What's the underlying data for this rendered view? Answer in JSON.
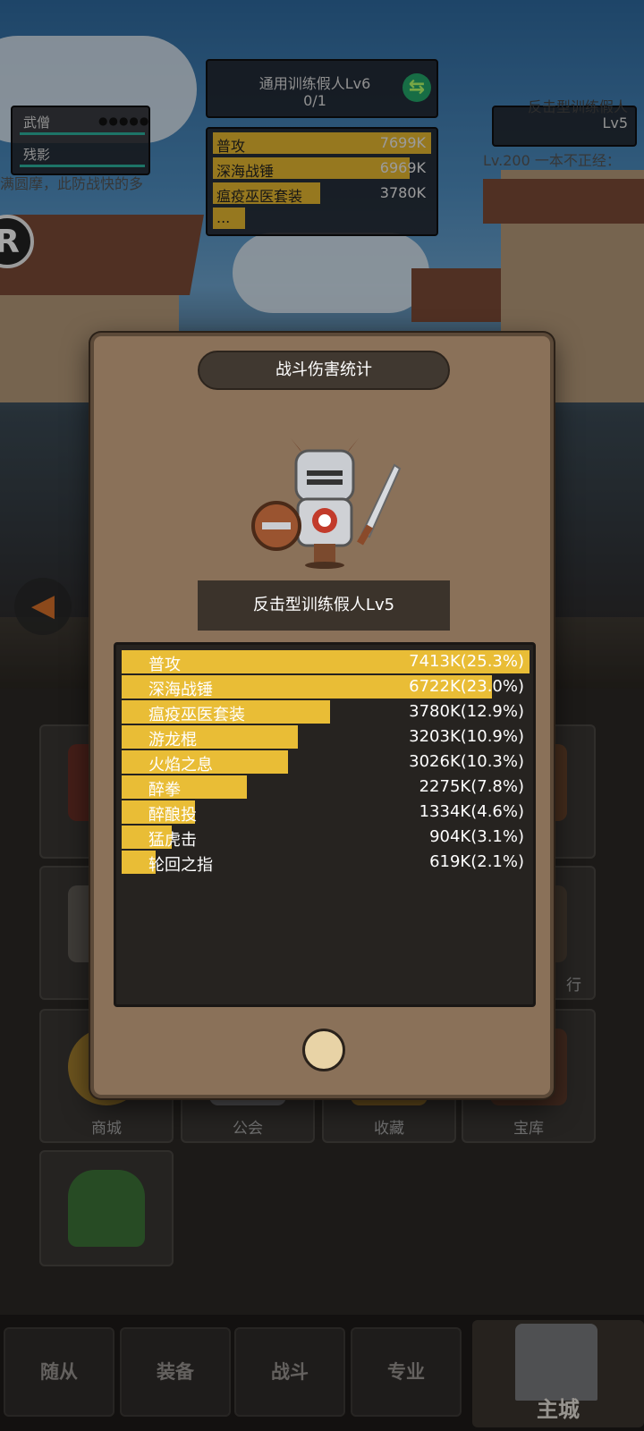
{
  "background": {
    "tags": [
      "武僧",
      "残影"
    ],
    "tag_stars": "●●●●●",
    "scroll_text": "满圆摩，此防战快的多",
    "r_badge": "R",
    "target": {
      "title": "通用训练假人Lv6",
      "count": "0/1"
    },
    "mini_stats": [
      {
        "name": "普攻",
        "value": "7699K",
        "fill": 1.0
      },
      {
        "name": "深海战锤",
        "value": "6969K",
        "fill": 0.9
      },
      {
        "name": "瘟疫巫医套装",
        "value": "3780K",
        "fill": 0.49
      },
      {
        "name": "...",
        "value": "",
        "fill": 0.15
      }
    ],
    "right_panel": {
      "title": "反击型训练假人",
      "level": "Lv5",
      "text": "Lv.200 一本不正经："
    },
    "back_icon": "arrow-left-icon"
  },
  "menu": {
    "tiles": [
      {
        "label": "",
        "icon": "item-icon"
      },
      {
        "label": "",
        "icon": "item-icon"
      },
      {
        "label": "",
        "icon": "item-icon"
      },
      {
        "label": "",
        "icon": "item-icon"
      },
      {
        "label": "商城",
        "icon": "coin-icon"
      },
      {
        "label": "公会",
        "icon": "guild-icon"
      },
      {
        "label": "收藏",
        "icon": "collection-icon"
      },
      {
        "label": "宝库",
        "icon": "vault-icon"
      }
    ],
    "edge_label": "行"
  },
  "bottom_nav": {
    "items": [
      "随从",
      "装备",
      "战斗",
      "专业"
    ],
    "main": "主城"
  },
  "modal": {
    "title": "战斗伤害统计",
    "target_name": "反击型训练假人Lv5",
    "stats": [
      {
        "name": "普攻",
        "value": "7413K(25.3%)",
        "fraction": 1.0
      },
      {
        "name": "深海战锤",
        "value": "6722K(23.0%)",
        "fraction": 0.907
      },
      {
        "name": "瘟疫巫医套装",
        "value": "3780K(12.9%)",
        "fraction": 0.51
      },
      {
        "name": "游龙棍",
        "value": "3203K(10.9%)",
        "fraction": 0.432
      },
      {
        "name": "火焰之息",
        "value": "3026K(10.3%)",
        "fraction": 0.408
      },
      {
        "name": "醉拳",
        "value": "2275K(7.8%)",
        "fraction": 0.307
      },
      {
        "name": "醉酿投",
        "value": "1334K(4.6%)",
        "fraction": 0.18
      },
      {
        "name": "猛虎击",
        "value": "904K(3.1%)",
        "fraction": 0.122
      },
      {
        "name": "轮回之指",
        "value": "619K(2.1%)",
        "fraction": 0.084
      }
    ],
    "close_icon": "close-circle-icon"
  }
}
